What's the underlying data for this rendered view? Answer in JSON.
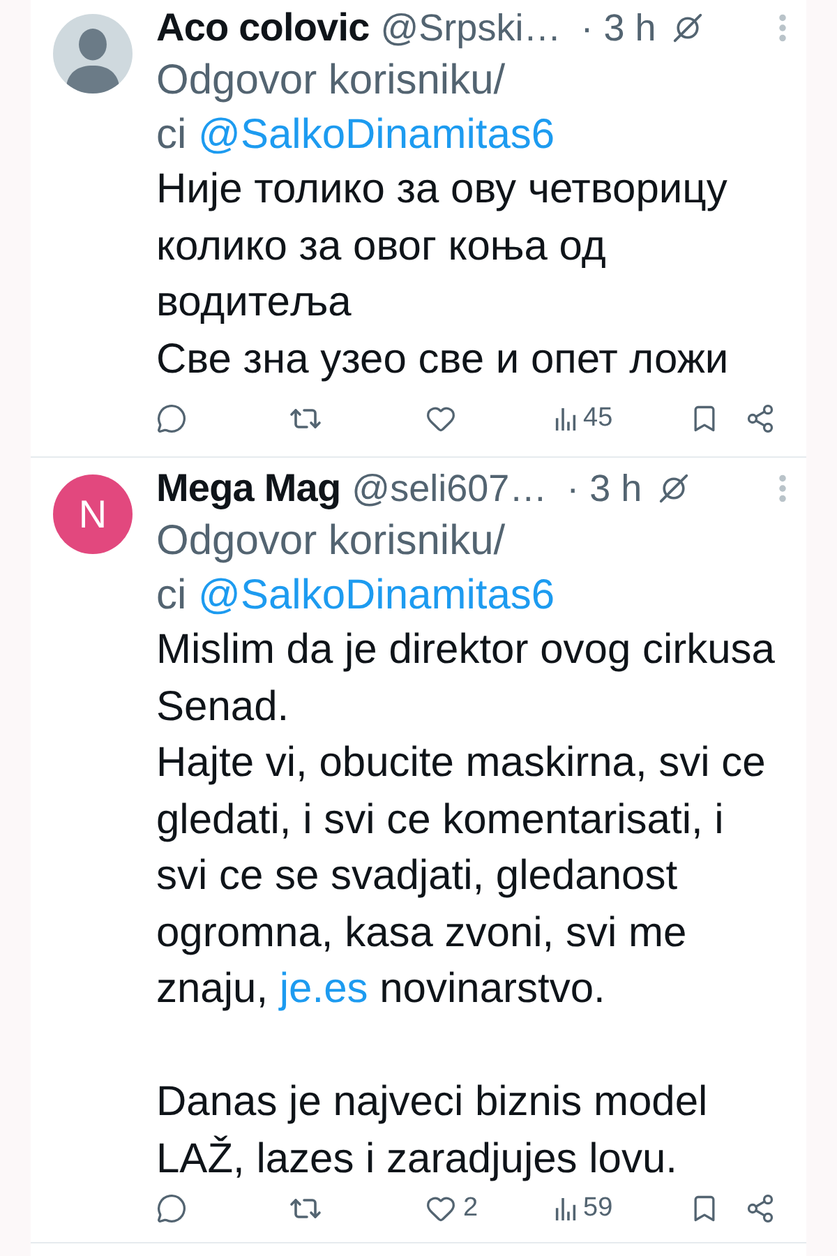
{
  "posts": [
    {
      "author": {
        "name": "Aco colovic",
        "handle": "@Srpski…",
        "avatar": {
          "kind": "silhouette"
        }
      },
      "time": "· 3 h",
      "reply_context": [
        [
          {
            "kind": "text",
            "text": "Odgovor korisniku/"
          }
        ],
        [
          {
            "kind": "text",
            "text": "ci "
          },
          {
            "kind": "link",
            "text": "@SalkoDinamitas6"
          }
        ]
      ],
      "paragraphs": [
        [
          [
            {
              "kind": "text",
              "text": "Није толико за ову четворицу"
            }
          ],
          [
            {
              "kind": "text",
              "text": "колико за овог коња од"
            }
          ],
          [
            {
              "kind": "text",
              "text": "водитеља"
            }
          ],
          [
            {
              "kind": "text",
              "text": "Све зна узео све и опет ложи"
            }
          ]
        ]
      ],
      "actions": [
        {
          "kind": "reply"
        },
        {
          "kind": "repost"
        },
        {
          "kind": "like"
        },
        {
          "kind": "views",
          "count": "45"
        },
        {
          "kind": "bookmark"
        },
        {
          "kind": "share"
        }
      ]
    },
    {
      "author": {
        "name": "Mega Mag",
        "handle": "@seli607…",
        "avatar": {
          "kind": "letter",
          "letter": "N",
          "color": "#e2487e"
        }
      },
      "time": "· 3 h",
      "reply_context": [
        [
          {
            "kind": "text",
            "text": "Odgovor korisniku/"
          }
        ],
        [
          {
            "kind": "text",
            "text": "ci "
          },
          {
            "kind": "link",
            "text": "@SalkoDinamitas6"
          }
        ]
      ],
      "paragraphs": [
        [
          [
            {
              "kind": "text",
              "text": "Mislim da je direktor ovog cirkusa"
            }
          ],
          [
            {
              "kind": "text",
              "text": "Senad."
            }
          ],
          [
            {
              "kind": "text",
              "text": "Hajte vi, obucite maskirna, svi ce"
            }
          ],
          [
            {
              "kind": "text",
              "text": "gledati, i svi ce komentarisati, i"
            }
          ],
          [
            {
              "kind": "text",
              "text": "svi ce se svadjati, gledanost"
            }
          ],
          [
            {
              "kind": "text",
              "text": "ogromna, kasa zvoni, svi me"
            }
          ],
          [
            {
              "kind": "text",
              "text": "znaju, "
            },
            {
              "kind": "link",
              "text": "je.es"
            },
            {
              "kind": "text",
              "text": " novinarstvo."
            }
          ]
        ],
        [
          [
            {
              "kind": "text",
              "text": "Danas je najveci biznis model"
            }
          ],
          [
            {
              "kind": "text",
              "text": "LAŽ, lazes i zaradjujes lovu."
            }
          ]
        ]
      ],
      "actions": [
        {
          "kind": "reply"
        },
        {
          "kind": "repost"
        },
        {
          "kind": "like",
          "count": "2"
        },
        {
          "kind": "views",
          "count": "59"
        },
        {
          "kind": "bookmark"
        },
        {
          "kind": "share"
        }
      ]
    }
  ]
}
